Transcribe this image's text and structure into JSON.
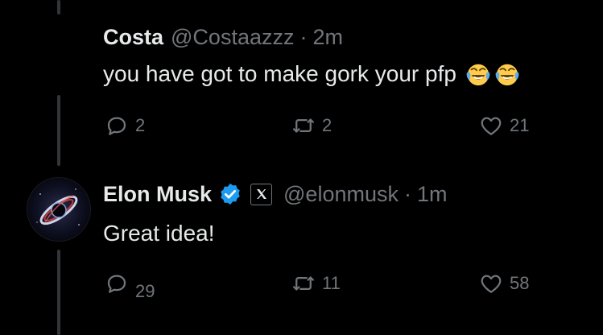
{
  "tweets": [
    {
      "name": "Costa",
      "handle": "@Costaazzz",
      "separator": "·",
      "time": "2m",
      "text": "you have got to make gork your pfp",
      "emoji": [
        "face-with-tears-of-joy",
        "face-with-tears-of-joy"
      ],
      "reply_count": "2",
      "repost_count": "2",
      "like_count": "21"
    },
    {
      "name": "Elon Musk",
      "handle": "@elonmusk",
      "separator": "·",
      "time": "1m",
      "text": "Great idea!",
      "reply_count": "29",
      "repost_count": "11",
      "like_count": "58"
    }
  ],
  "colors": {
    "background": "#000000",
    "text_primary": "#e7e9ea",
    "text_secondary": "#71767b",
    "verified_blue": "#1d9bf0",
    "thread_line": "#333639"
  },
  "icons": {
    "reply": "reply-icon",
    "repost": "repost-icon",
    "like": "heart-icon",
    "verified": "verified-badge-icon",
    "affiliate": "x-logo-icon"
  }
}
